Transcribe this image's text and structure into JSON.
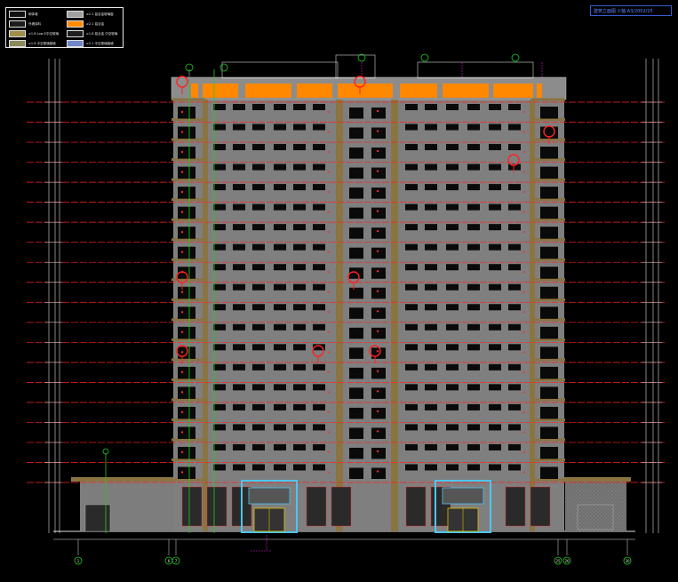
{
  "legend": {
    "items": [
      {
        "label": "砌体墙",
        "color": "#111111"
      },
      {
        "label": "≥2.1 铝合金玻璃窗",
        "color": "#a0a0a0"
      },
      {
        "label": "外墙涂料",
        "color": "#1c1c1c"
      },
      {
        "label": "≥2.1 铝合金",
        "color": "#ff8c00"
      },
      {
        "label": "≥1.8 Low-E中空玻璃",
        "color": "#a08e4a"
      },
      {
        "label": "≥1.8 铝合金 中空玻璃",
        "color": "#1f1f1f"
      },
      {
        "label": "≥1.8 中空玻璃幕墙",
        "color": "#8b8a5a"
      },
      {
        "label": "≥2.1 中空玻璃幕墙",
        "color": "#6f87c8"
      }
    ]
  },
  "title_block": {
    "text": "建筑立面图 ①轴 A3/2002/25"
  },
  "colors": {
    "background": "#000000",
    "facade": "#808080",
    "band": "#8a7442",
    "roof_orange": "#ff8800",
    "red_line": "#ff2020",
    "green_line": "#22cc22",
    "cyan_frame": "#4cc6f0",
    "magenta_dim": "#d020d0",
    "window": "#0a0a0a"
  },
  "axes": {
    "bottom": [
      {
        "label": "1"
      },
      {
        "label": "6"
      },
      {
        "label": "7"
      },
      {
        "label": "25"
      },
      {
        "label": "26"
      },
      {
        "label": "30"
      }
    ]
  },
  "drawing": {
    "floors": 19
  }
}
